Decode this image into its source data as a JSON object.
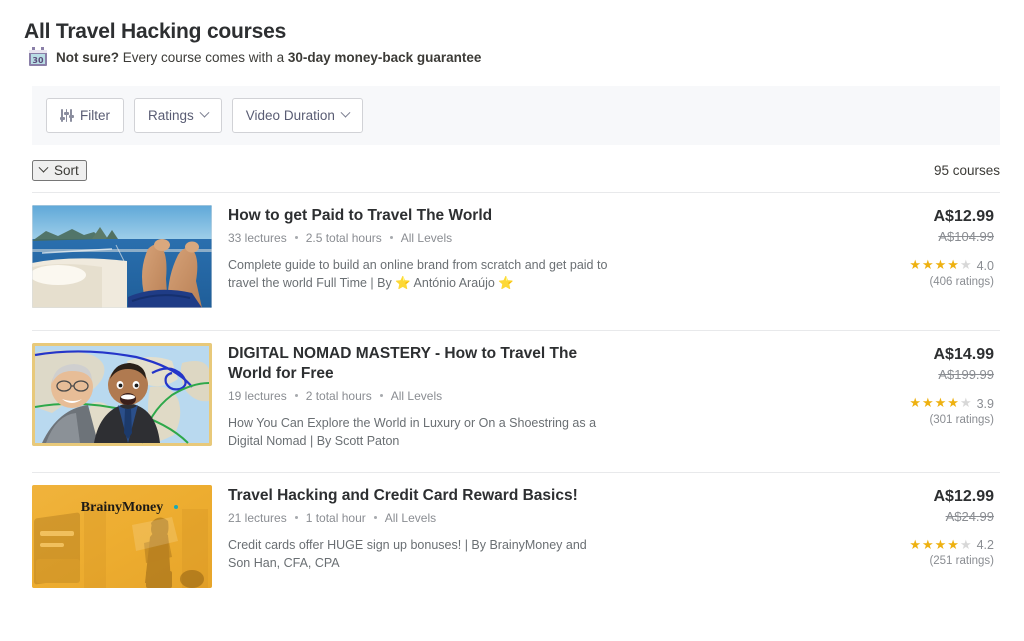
{
  "header": {
    "title": "All Travel Hacking courses",
    "guarantee_icon": "calendar-30-icon",
    "guarantee_bold_lead": "Not sure?",
    "guarantee_mid": " Every course comes with a ",
    "guarantee_bold_tail": "30-day money-back guarantee"
  },
  "filters": {
    "filter_label": "Filter",
    "filter_icon": "sliders-icon",
    "ratings_label": "Ratings",
    "video_duration_label": "Video Duration"
  },
  "sort": {
    "label": "Sort",
    "course_count": "95 courses"
  },
  "courses": [
    {
      "title": "How to get Paid to Travel The World",
      "lectures": "33 lectures",
      "duration": "2.5 total hours",
      "level": "All Levels",
      "description": "Complete guide to build an online brand from scratch and get paid to travel the world Full Time | By ⭐ António Araújo ⭐",
      "price_now": "A$12.99",
      "price_old": "A$104.99",
      "rating": "4.0",
      "stars_filled": 4,
      "rating_count": "(406 ratings)",
      "thumb": "boat-sea-legs-photo"
    },
    {
      "title": "DIGITAL NOMAD MASTERY - How to Travel The World for Free",
      "lectures": "19 lectures",
      "duration": "2 total hours",
      "level": "All Levels",
      "description": "How You Can Explore the World in Luxury or On a Shoestring as a Digital Nomad | By Scott Paton",
      "price_now": "A$14.99",
      "price_old": "A$199.99",
      "rating": "3.9",
      "stars_filled": 4,
      "rating_count": "(301 ratings)",
      "thumb": "two-men-world-map-photo"
    },
    {
      "title": "Travel Hacking and Credit Card Reward Basics!",
      "lectures": "21 lectures",
      "duration": "1 total hour",
      "level": "All Levels",
      "description": "Credit cards offer HUGE sign up bonuses! | By BrainyMoney and Son Han, CFA, CPA",
      "price_now": "A$12.99",
      "price_old": "A$24.99",
      "rating": "4.2",
      "stars_filled": 4,
      "rating_count": "(251 ratings)",
      "thumb": "brainymoney-orange-photo",
      "thumb_text": "BrainyMoney"
    }
  ],
  "colors": {
    "text_dark": "#2d2f31",
    "text_muted": "#6a6f73",
    "star_gold": "#eeb111",
    "filter_bar_bg": "#f7f8fa",
    "divider": "#e8e9eb"
  }
}
